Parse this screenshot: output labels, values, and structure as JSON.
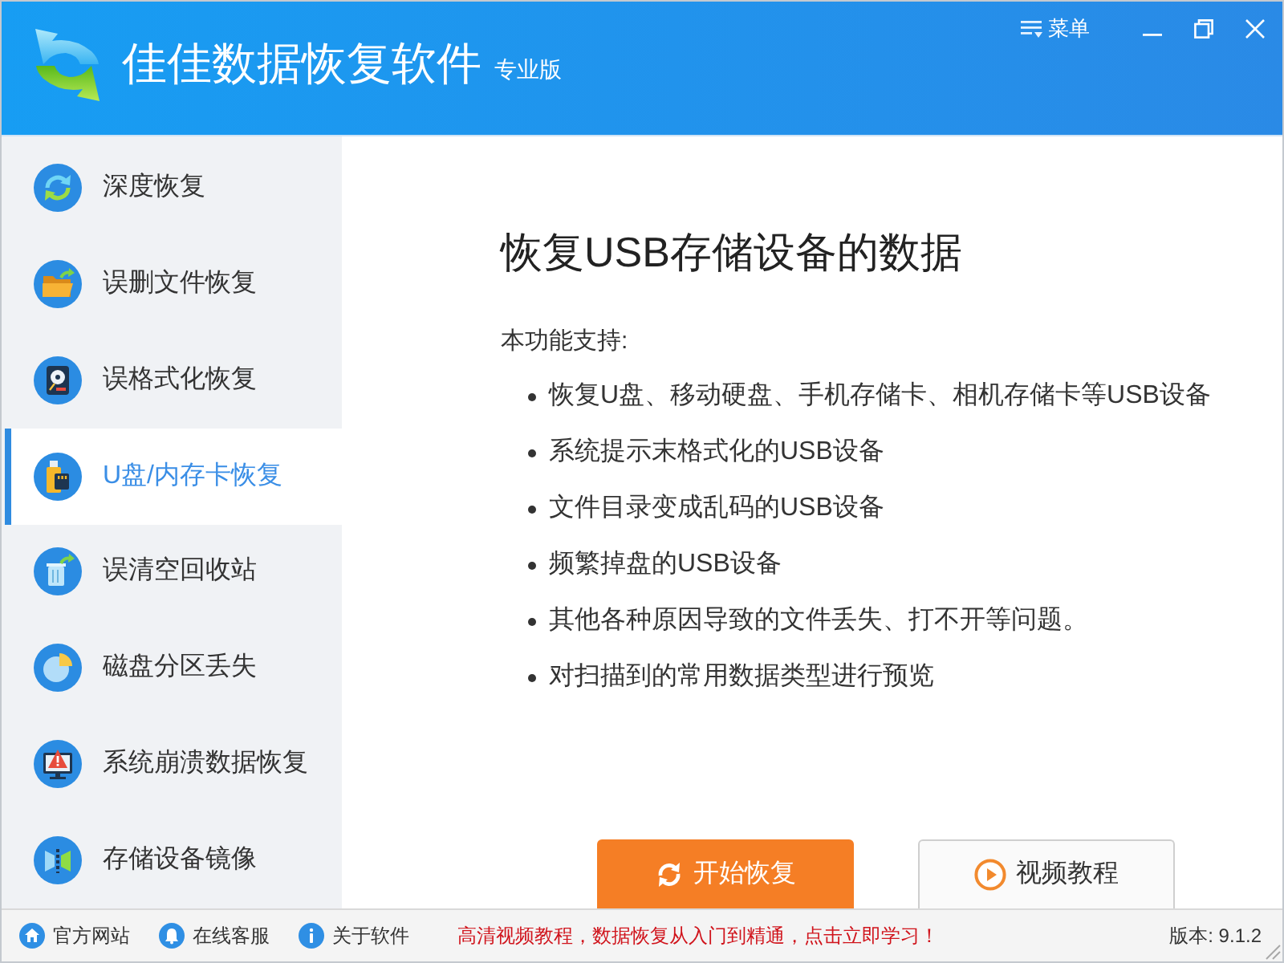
{
  "window": {
    "title": "佳佳数据恢复软件",
    "edition": "专业版",
    "menu_label": "菜单"
  },
  "sidebar": {
    "items": [
      {
        "label": "深度恢复",
        "selected": false
      },
      {
        "label": "误删文件恢复",
        "selected": false
      },
      {
        "label": "误格式化恢复",
        "selected": false
      },
      {
        "label": "U盘/内存卡恢复",
        "selected": true
      },
      {
        "label": "误清空回收站",
        "selected": false
      },
      {
        "label": "磁盘分区丢失",
        "selected": false
      },
      {
        "label": "系统崩溃数据恢复",
        "selected": false
      },
      {
        "label": "存储设备镜像",
        "selected": false
      }
    ]
  },
  "content": {
    "heading": "恢复USB存储设备的数据",
    "intro": "本功能支持:",
    "features": [
      "恢复U盘、移动硬盘、手机存储卡、相机存储卡等USB设备",
      "系统提示末格式化的USB设备",
      "文件目录变成乱码的USB设备",
      "频繁掉盘的USB设备",
      "其他各种原因导致的文件丢失、打不开等问题。",
      "对扫描到的常用数据类型进行预览"
    ]
  },
  "buttons": [
    {
      "label": "开始恢复",
      "kind": "primary"
    },
    {
      "label": "视频教程",
      "kind": "secondary"
    }
  ],
  "status_bar": {
    "links": [
      "官方网站",
      "在线客服",
      "关于软件"
    ],
    "promo": "高清视频教程，数据恢复从入门到精通，点击立即学习！",
    "version": "版本: 9.1.2"
  }
}
